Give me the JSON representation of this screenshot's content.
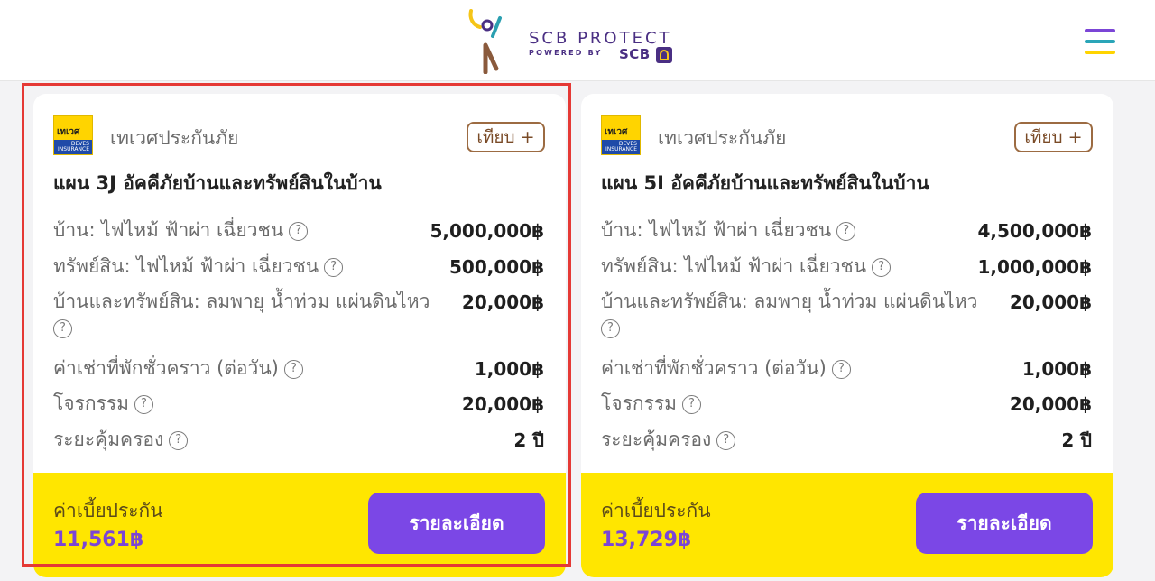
{
  "header": {
    "brand_title": "SCB PROTECT",
    "brand_powered_by": "POWERED BY",
    "brand_scb": "SCB",
    "brand_colors": {
      "purple": "#4a2f83",
      "yellow": "#f5c518",
      "brown": "#8a5a3c",
      "teal": "#2a9fb0"
    },
    "menu_icon": "hamburger-icon",
    "menu_colors": [
      "#7b45d6",
      "#2aa5b8",
      "#ffd400"
    ]
  },
  "cards": [
    {
      "insurer_logo_text": "เทเวศ",
      "insurer_logo_sub": "DEVES INSURANCE",
      "insurer_name": "เทเวศประกันภัย",
      "compare_label": "เทียบ +",
      "plan_title": "แผน 3J อัคคีภัยบ้านและทรัพย์สินในบ้าน",
      "coverages": [
        {
          "label": "บ้าน: ไฟไหม้ ฟ้าผ่า เฉี่ยวชน",
          "value": "5,000,000฿"
        },
        {
          "label": "ทรัพย์สิน: ไฟไหม้ ฟ้าผ่า เฉี่ยวชน",
          "value": "500,000฿"
        },
        {
          "label": "บ้านและทรัพย์สิน: ลมพายุ น้ำท่วม แผ่นดินไหว",
          "value": "20,000฿"
        },
        {
          "label": "ค่าเช่าที่พักชั่วคราว (ต่อวัน)",
          "value": "1,000฿"
        },
        {
          "label": "โจรกรรม",
          "value": "20,000฿"
        },
        {
          "label": "ระยะคุ้มครอง",
          "value": "2 ปี"
        }
      ],
      "premium_label": "ค่าเบี้ยประกัน",
      "premium_value": "11,561฿",
      "detail_label": "รายละเอียด",
      "highlighted": true
    },
    {
      "insurer_logo_text": "เทเวศ",
      "insurer_logo_sub": "DEVES INSURANCE",
      "insurer_name": "เทเวศประกันภัย",
      "compare_label": "เทียบ +",
      "plan_title": "แผน 5I อัคคีภัยบ้านและทรัพย์สินในบ้าน",
      "coverages": [
        {
          "label": "บ้าน: ไฟไหม้ ฟ้าผ่า เฉี่ยวชน",
          "value": "4,500,000฿"
        },
        {
          "label": "ทรัพย์สิน: ไฟไหม้ ฟ้าผ่า เฉี่ยวชน",
          "value": "1,000,000฿"
        },
        {
          "label": "บ้านและทรัพย์สิน: ลมพายุ น้ำท่วม แผ่นดินไหว",
          "value": "20,000฿"
        },
        {
          "label": "ค่าเช่าที่พักชั่วคราว (ต่อวัน)",
          "value": "1,000฿"
        },
        {
          "label": "โจรกรรม",
          "value": "20,000฿"
        },
        {
          "label": "ระยะคุ้มครอง",
          "value": "2 ปี"
        }
      ],
      "premium_label": "ค่าเบี้ยประกัน",
      "premium_value": "13,729฿",
      "detail_label": "รายละเอียด",
      "highlighted": false
    }
  ],
  "colors": {
    "accent_purple": "#7b47e6",
    "footer_yellow": "#ffe600",
    "highlight_red": "#e53935"
  }
}
